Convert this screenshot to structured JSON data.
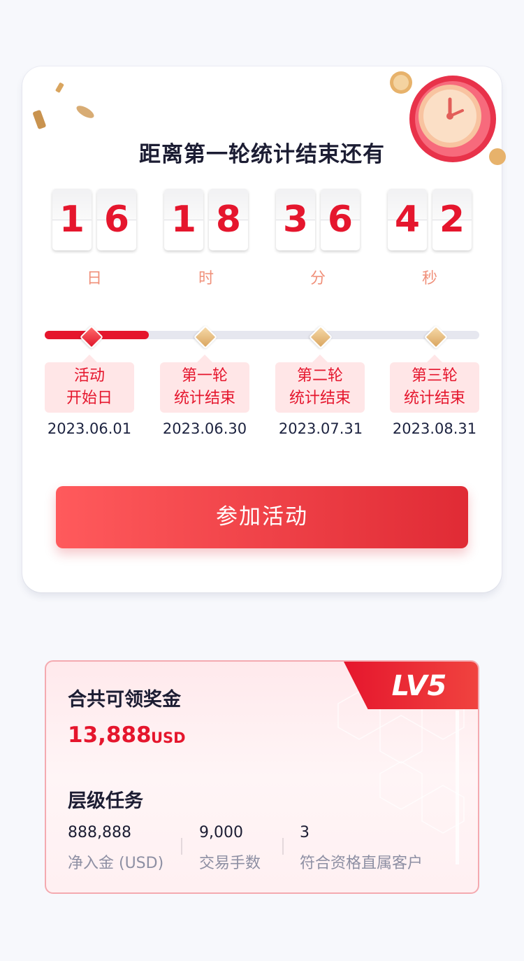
{
  "countdown": {
    "title": "距离第一轮统计结束还有",
    "days": [
      "1",
      "6"
    ],
    "hours": [
      "1",
      "8"
    ],
    "minutes": [
      "3",
      "6"
    ],
    "seconds": [
      "4",
      "2"
    ],
    "units": {
      "days": "日",
      "hours": "时",
      "minutes": "分",
      "seconds": "秒"
    }
  },
  "timeline": {
    "progress_fraction": 0.24,
    "milestones": [
      {
        "line1": "活动",
        "line2": "开始日",
        "date": "2023.06.01"
      },
      {
        "line1": "第一轮",
        "line2": "统计结束",
        "date": "2023.06.30"
      },
      {
        "line1": "第二轮",
        "line2": "统计结束",
        "date": "2023.07.31"
      },
      {
        "line1": "第三轮",
        "line2": "统计结束",
        "date": "2023.08.31"
      }
    ]
  },
  "join_button": "参加活动",
  "reward": {
    "level": "LV5",
    "title": "合共可领奖金",
    "amount": "13,888",
    "currency": "USD",
    "task_title": "层级任务",
    "tasks": [
      {
        "value": "888,888",
        "label": "净入金 (USD)"
      },
      {
        "value": "9,000",
        "label": "交易手数"
      },
      {
        "value": "3",
        "label": "符合资格直属客户"
      }
    ]
  },
  "colors": {
    "accent": "#e5162d",
    "label_bg": "#ffe6e7",
    "unit": "#f0907a",
    "gold": "#d9a55f"
  },
  "icons": [
    "clock-icon",
    "coin-icon",
    "confetti-icon"
  ]
}
